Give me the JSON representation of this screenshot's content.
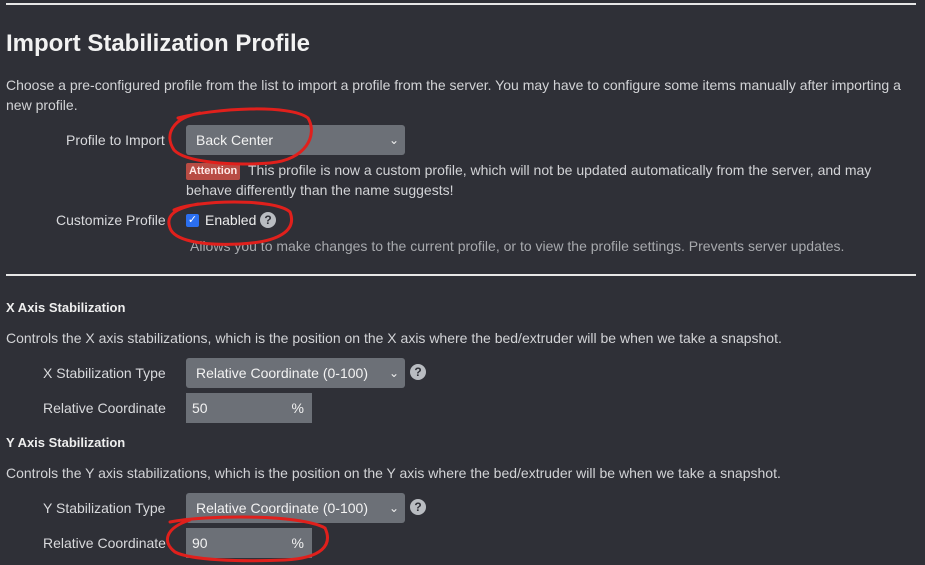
{
  "page": {
    "title": "Import Stabilization Profile",
    "intro": "Choose a pre-configured profile from the list to import a profile from the server. You may have to configure some items manually after importing a new profile."
  },
  "profile_import": {
    "label": "Profile to Import",
    "selected": "Back Center",
    "attention_badge": "Attention",
    "attention_text": "This profile is now a custom profile, which will not be updated automatically from the server, and may behave differently than the name suggests!"
  },
  "customize": {
    "label": "Customize Profile",
    "checkbox_label": "Enabled",
    "checked": true,
    "help": "Allows you to make changes to the current profile, or to view the profile settings. Prevents server updates."
  },
  "x_axis": {
    "heading": "X Axis Stabilization",
    "description": "Controls the X axis stabilizations, which is the position on the X axis where the bed/extruder will be when we take a snapshot.",
    "type_label": "X Stabilization Type",
    "type_value": "Relative Coordinate (0-100)",
    "coord_label": "Relative Coordinate",
    "coord_value": "50",
    "unit": "%"
  },
  "y_axis": {
    "heading": "Y Axis Stabilization",
    "description": "Controls the Y axis stabilizations, which is the position on the Y axis where the bed/extruder will be when we take a snapshot.",
    "type_label": "Y Stabilization Type",
    "type_value": "Relative Coordinate (0-100)",
    "coord_label": "Relative Coordinate",
    "coord_value": "90",
    "unit": "%"
  },
  "icons": {
    "help": "?",
    "chevron": "⌄",
    "check": "✓"
  },
  "annotation_color": "#e0201c"
}
